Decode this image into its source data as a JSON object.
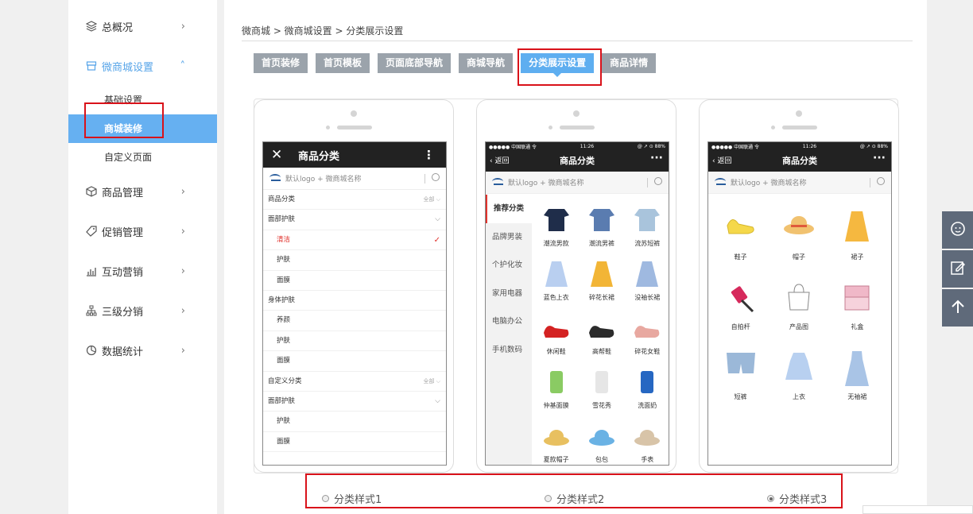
{
  "sidebar": {
    "items": [
      {
        "label": "总概况",
        "icon": "layers-icon"
      },
      {
        "label": "微商城设置",
        "icon": "store-icon"
      },
      {
        "label": "商品管理",
        "icon": "box-icon"
      },
      {
        "label": "促销管理",
        "icon": "tag-icon"
      },
      {
        "label": "互动营销",
        "icon": "bar-chart-icon"
      },
      {
        "label": "三级分销",
        "icon": "hierarchy-icon"
      },
      {
        "label": "数据统计",
        "icon": "pie-chart-icon"
      }
    ],
    "subitems": [
      {
        "label": "基础设置"
      },
      {
        "label": "商城装修"
      },
      {
        "label": "自定义页面"
      }
    ]
  },
  "breadcrumb": "微商城 > 微商城设置 > 分类展示设置",
  "tabs": [
    {
      "label": "首页装修"
    },
    {
      "label": "首页模板"
    },
    {
      "label": "页面底部导航"
    },
    {
      "label": "商城导航"
    },
    {
      "label": "分类展示设置"
    },
    {
      "label": "商品详情"
    }
  ],
  "phone1": {
    "title": "商品分类",
    "search": "默认logo + 微商城名称",
    "rows": [
      {
        "text": "商品分类",
        "right": "全部"
      },
      {
        "text": "面部护肤"
      },
      {
        "text": "清洁"
      },
      {
        "text": "护肤"
      },
      {
        "text": "面膜"
      },
      {
        "text": "身体护肤"
      },
      {
        "text": "养颜"
      },
      {
        "text": "护肤"
      },
      {
        "text": "面膜"
      },
      {
        "text": "自定义分类",
        "right": "全部"
      },
      {
        "text": "面部护肤"
      },
      {
        "text": "护肤"
      },
      {
        "text": "面膜"
      }
    ]
  },
  "phone2": {
    "status_left": "●●●●● 中国联通 令",
    "status_time": "11:26",
    "status_right": "@ ↗ ⊙ 88%",
    "back": "返回",
    "title": "商品分类",
    "search": "默认logo + 微商城名称",
    "left_categories": [
      "推荐分类",
      "品牌男装",
      "个护化妆",
      "家用电器",
      "电脑办公",
      "手机数码"
    ],
    "products": [
      "潮流男款",
      "潮流男裤",
      "流苏短裤",
      "蓝色上衣",
      "碎花长裙",
      "没袖长裙",
      "休闲鞋",
      "高帮鞋",
      "碎花女鞋",
      "仲基面膜",
      "雪花秀",
      "洗面奶",
      "夏款帽子",
      "包包",
      "手表"
    ]
  },
  "phone3": {
    "status_left": "●●●●● 中国联通 令",
    "status_time": "11:26",
    "status_right": "@ ↗ ⊙ 88%",
    "back": "返回",
    "title": "商品分类",
    "search": "默认logo + 微商城名称",
    "products": [
      "鞋子",
      "帽子",
      "裙子",
      "自拍杆",
      "产品图",
      "礼盒",
      "短裤",
      "上衣",
      "无袖裙"
    ]
  },
  "styles": [
    {
      "label": "分类样式1",
      "checked": false
    },
    {
      "label": "分类样式2",
      "checked": false
    },
    {
      "label": "分类样式3",
      "checked": true
    }
  ],
  "colors": {
    "accent": "#5eaef0",
    "highlight_border": "#d9121a",
    "tab_inactive": "#9ba3ab"
  }
}
